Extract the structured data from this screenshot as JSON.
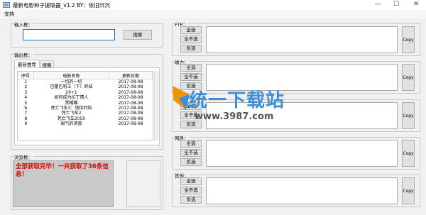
{
  "window": {
    "title": "最新电影种子提取器_v1.2   BY：依旧沉沉",
    "minimize": "—",
    "maximize": "☐",
    "close": "✕"
  },
  "menu": {
    "support": "支持"
  },
  "input_box": {
    "label": "输入框：",
    "value": "",
    "search_button": "搜索"
  },
  "output_box": {
    "label": "输出框：",
    "tabs": [
      "最新推荐",
      "搜索"
    ],
    "columns": [
      "序号",
      "电影名称",
      "更新日期"
    ],
    "rows": [
      [
        "1",
        "一切的一切",
        "2017-08-08"
      ],
      [
        "2",
        "巴霍巴利王（下）终结",
        "2017-08-08"
      ],
      [
        "3",
        "29+1",
        "2017-08-08"
      ],
      [
        "4",
        "如何成为拉丁情人",
        "2017-08-08"
      ],
      [
        "5",
        "黑蝴蝶",
        "2017-08-08"
      ],
      [
        "6",
        "死亡飞车3：地狱烈焰",
        "2017-08-08"
      ],
      [
        "7",
        "死亡飞车2",
        "2017-08-08"
      ],
      [
        "8",
        "死亡飞车2050",
        "2017-08-08"
      ],
      [
        "9",
        "闺气的诱惑",
        "2017-08-08"
      ]
    ]
  },
  "browser_box": {
    "label": "浏览框：",
    "text": "全部获取完毕！一共获取了36条信息！"
  },
  "link_groups": [
    {
      "label": "FTP：",
      "select_all": "全选",
      "deselect_all": "全不选",
      "invert": "反选",
      "copy": "Copy"
    },
    {
      "label": "磁力：",
      "select_all": "全选",
      "deselect_all": "全不选",
      "invert": "反选",
      "copy": "Copy"
    },
    {
      "label": "电驴：",
      "select_all": "全选",
      "deselect_all": "全不选",
      "invert": "反选",
      "copy": "Copy"
    },
    {
      "label": "网盘：",
      "select_all": "全选",
      "deselect_all": "全不选",
      "invert": "反选",
      "copy": "Copy"
    },
    {
      "label": "其他：",
      "select_all": "全选",
      "deselect_all": "全不选",
      "invert": "反选",
      "copy": "Copy"
    }
  ],
  "watermark": {
    "text": "统一下载站",
    "url": "www.3987.com"
  },
  "colors": {
    "status_red": "#e00000",
    "watermark_blue": "#3c8ed8",
    "textbox_bg": "#ffffff"
  }
}
